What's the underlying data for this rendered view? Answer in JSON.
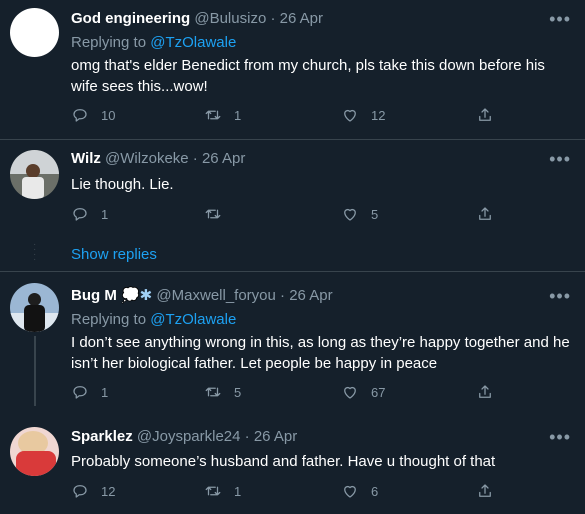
{
  "tweets": [
    {
      "name": "God engineering",
      "handle": "@Bulusizo",
      "date": "· 26 Apr",
      "replying_label": "Replying to",
      "replying_to": "@TzOlawale",
      "text": "omg that's elder Benedict from my church, pls take this down before his wife sees this...wow!",
      "replies": "10",
      "retweets": "1",
      "likes": "12",
      "avatar_color": "#ffffff"
    },
    {
      "name": "Wilz",
      "handle": "@Wilzokeke",
      "date": "· 26 Apr",
      "text": "Lie though. Lie.",
      "replies": "1",
      "retweets": "",
      "likes": "5",
      "avatar_color": "#6b6f68"
    },
    {
      "name": "Bug M",
      "name_emoji": "💭✱",
      "handle": "@Maxwell_foryou",
      "date": "· 26 Apr",
      "replying_label": "Replying to",
      "replying_to": "@TzOlawale",
      "text": "I don’t see anything wrong in this, as long as they’re happy together and he isn’t her biological father. Let people be happy in peace",
      "replies": "1",
      "retweets": "5",
      "likes": "67",
      "avatar_color": "#9bb7d4"
    },
    {
      "name": "Sparklez",
      "handle": "@Joysparkle24",
      "date": "· 26 Apr",
      "text": "Probably someone’s husband and father. Have u thought of that",
      "replies": "12",
      "retweets": "1",
      "likes": "6",
      "avatar_color": "#d94a4a"
    }
  ],
  "show_replies": "Show replies",
  "more_glyph": "•••",
  "colors": {
    "background": "#15202b",
    "link": "#1da1f2",
    "muted": "#8899a6",
    "divider": "#38444d"
  }
}
